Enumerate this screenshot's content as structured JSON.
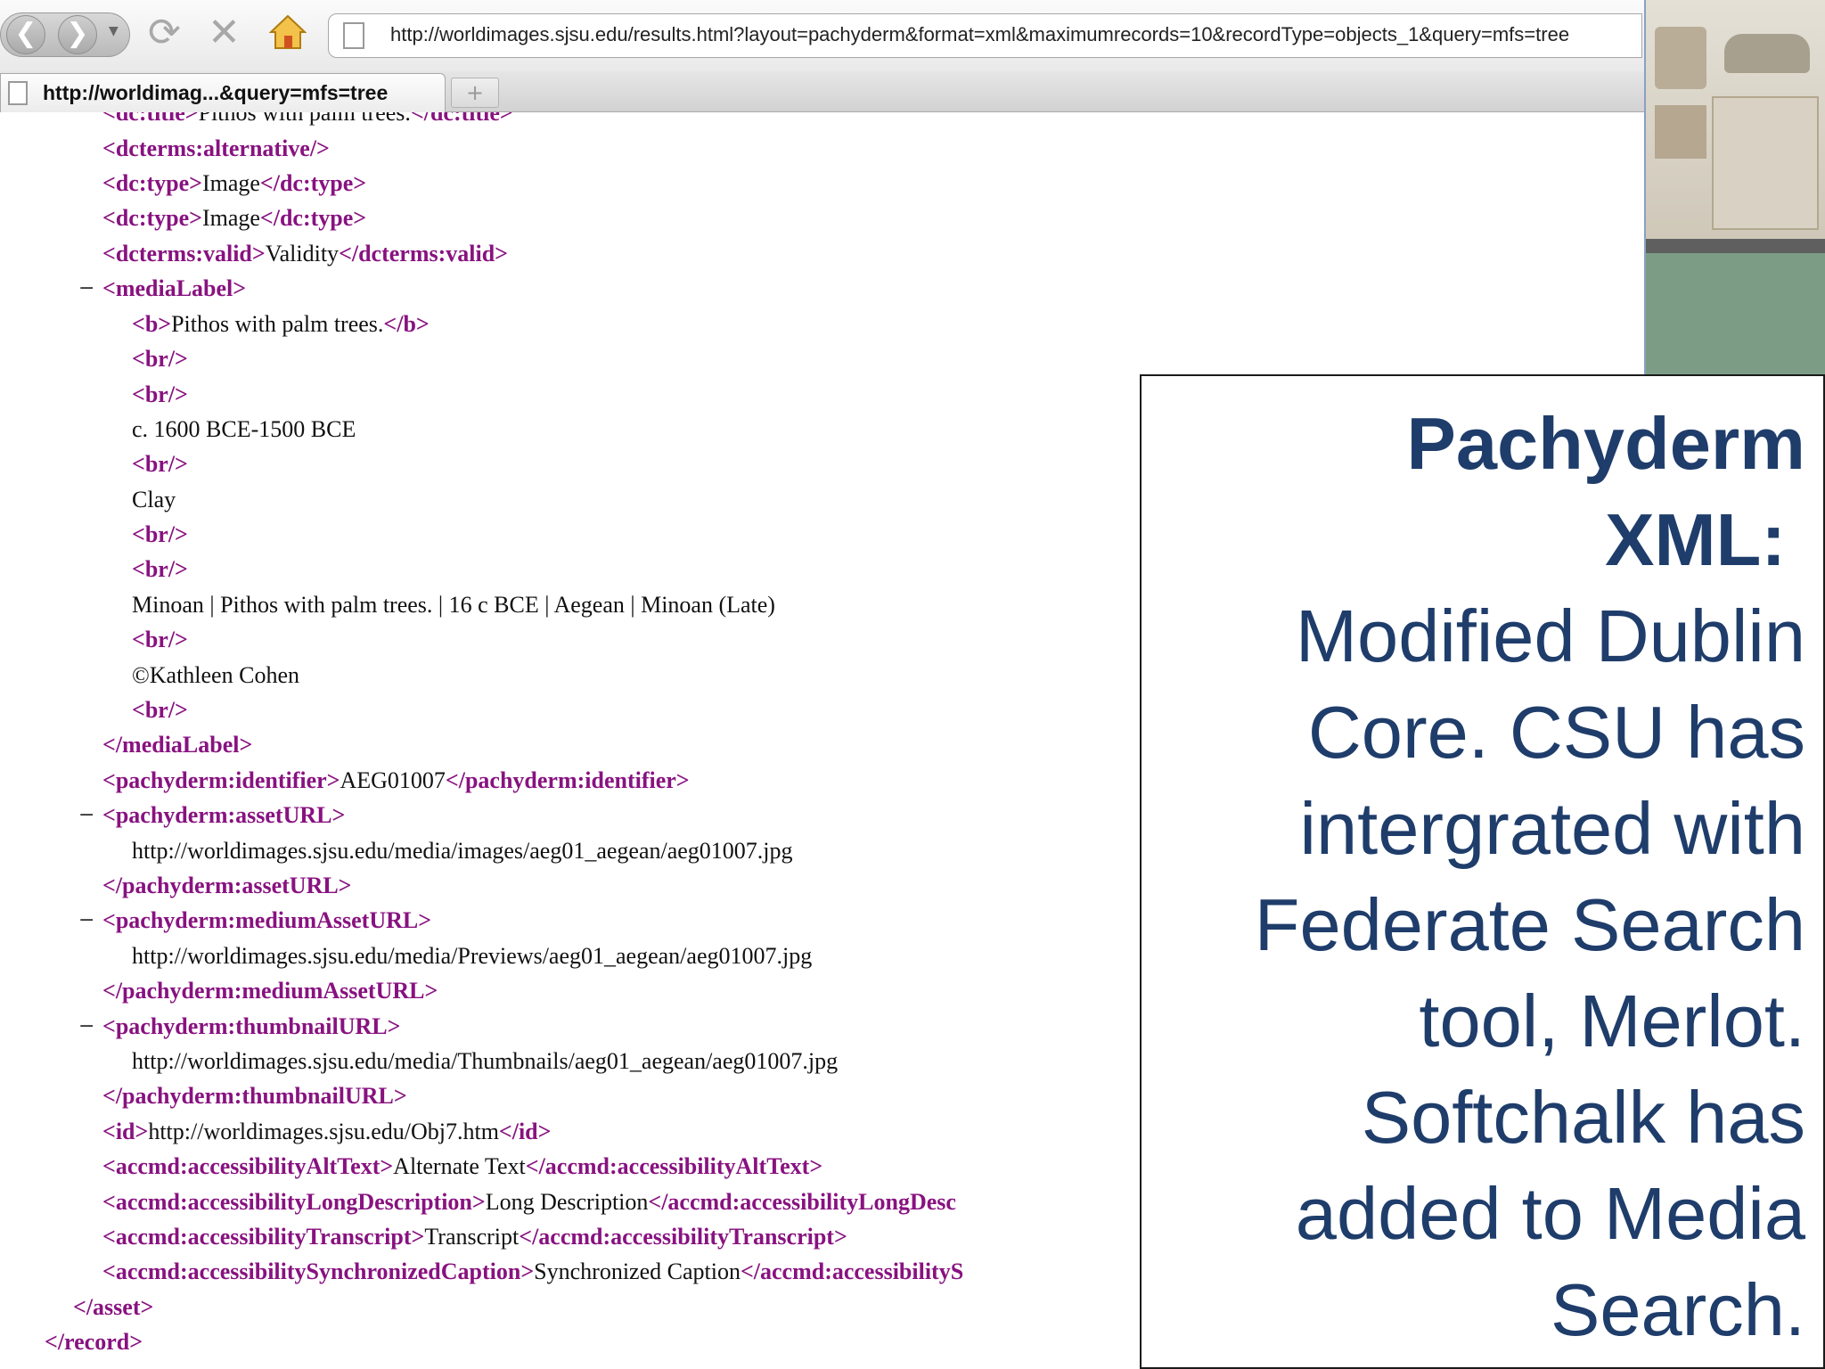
{
  "browser": {
    "nav_back_icon": "back-arrow-icon",
    "nav_forward_icon": "forward-arrow-icon",
    "reload_icon": "reload-icon",
    "stop_icon": "stop-icon",
    "home_icon": "home-icon",
    "url": "http://worldimages.sjsu.edu/results.html?layout=pachyderm&format=xml&maximumrecords=10&recordType=objects_1&query=mfs=tree",
    "tab_title": "http://worldimag...&query=mfs=tree",
    "new_tab_label": "+"
  },
  "xml": {
    "title_open": "<dc:title>",
    "title_text": "Pithos with palm trees.",
    "title_close": "</dc:title>",
    "alternative": "<dcterms:alternative/>",
    "type_open": "<dc:type>",
    "type_text": "Image",
    "type_close": "</dc:type>",
    "valid_open": "<dcterms:valid>",
    "valid_text": "Validity",
    "valid_close": "</dcterms:valid>",
    "media_label_open": "<mediaLabel>",
    "b_open": "<b>",
    "b_text": "Pithos with palm trees.",
    "b_close": "</b>",
    "br": "<br/>",
    "date": "c. 1600 BCE-1500 BCE",
    "material": "Clay",
    "summary": "Minoan | Pithos with palm trees. | 16 c BCE | Aegean | Minoan (Late)",
    "copyright": "©Kathleen Cohen",
    "media_label_close": "</mediaLabel>",
    "identifier_open": "<pachyderm:identifier>",
    "identifier_text": "AEG01007",
    "identifier_close": "</pachyderm:identifier>",
    "asset_open": "<pachyderm:assetURL>",
    "asset_text": "http://worldimages.sjsu.edu/media/images/aeg01_aegean/aeg01007.jpg",
    "asset_close": "</pachyderm:assetURL>",
    "medium_open": "<pachyderm:mediumAssetURL>",
    "medium_text": "http://worldimages.sjsu.edu/media/Previews/aeg01_aegean/aeg01007.jpg",
    "medium_close": "</pachyderm:mediumAssetURL>",
    "thumb_open": "<pachyderm:thumbnailURL>",
    "thumb_text": "http://worldimages.sjsu.edu/media/Thumbnails/aeg01_aegean/aeg01007.jpg",
    "thumb_close": "</pachyderm:thumbnailURL>",
    "id_open": "<id>",
    "id_text": "http://worldimages.sjsu.edu/Obj7.htm",
    "id_close": "</id>",
    "alt_open": "<accmd:accessibilityAltText>",
    "alt_text": "Alternate Text",
    "alt_close": "</accmd:accessibilityAltText>",
    "longdesc_open": "<accmd:accessibilityLongDescription>",
    "longdesc_text": "Long Description",
    "longdesc_close": "</accmd:accessibilityLongDesc",
    "transcript_open": "<accmd:accessibilityTranscript>",
    "transcript_text": "Transcript",
    "transcript_close": "</accmd:accessibilityTranscript>",
    "caption_open": "<accmd:accessibilitySynchronizedCaption>",
    "caption_text": "Synchronized Caption",
    "caption_close": "</accmd:accessibilityS",
    "asset_end": "</asset>",
    "record_end": "</record>",
    "collapse_toggle": "−"
  },
  "overlay": {
    "title_line1": "Pachyderm",
    "title_line2": "XML:",
    "body": "Modified Dublin Core.  CSU has intergrated with Federate Search tool, Merlot.  Softchalk has added to Media Search."
  }
}
